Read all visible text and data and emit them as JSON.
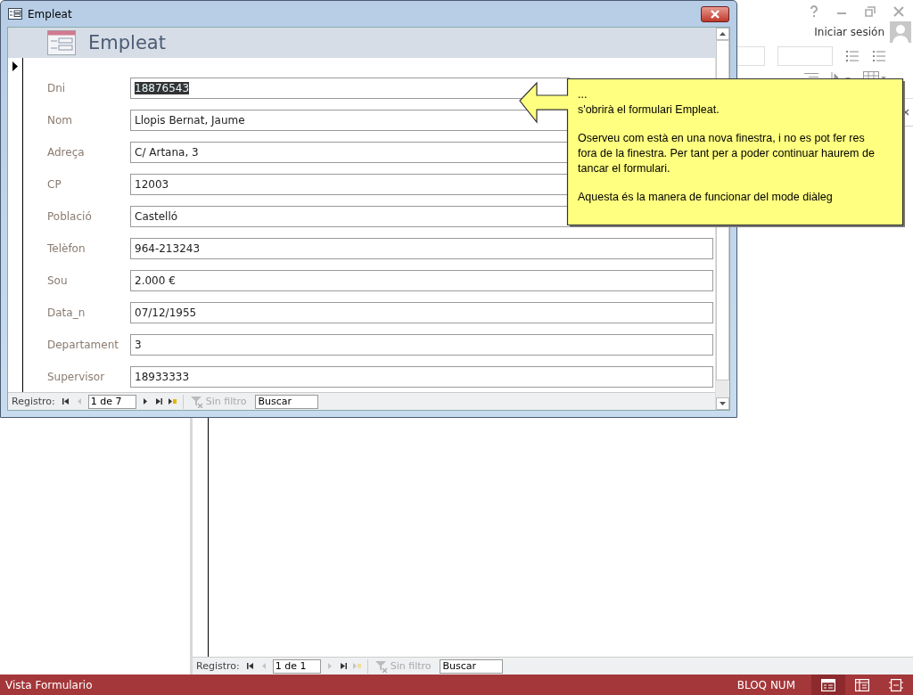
{
  "window": {
    "title": "Empleat"
  },
  "header": {
    "title": "Empleat"
  },
  "fields": [
    {
      "label": "Dni",
      "value": "18876543",
      "selected": true
    },
    {
      "label": "Nom",
      "value": "Llopis Bernat, Jaume",
      "selected": false
    },
    {
      "label": "Adreça",
      "value": "C/ Artana, 3",
      "selected": false
    },
    {
      "label": "CP",
      "value": "12003",
      "selected": false
    },
    {
      "label": "Població",
      "value": "Castelló",
      "selected": false
    },
    {
      "label": "Telèfon",
      "value": "964-213243",
      "selected": false
    },
    {
      "label": "Sou",
      "value": "2.000 €",
      "selected": false
    },
    {
      "label": "Data_n",
      "value": "07/12/1955",
      "selected": false
    },
    {
      "label": "Departament",
      "value": "3",
      "selected": false
    },
    {
      "label": "Supervisor",
      "value": "18933333",
      "selected": false
    }
  ],
  "navigation": {
    "label": "Registro:",
    "record": "1 de 7",
    "filter": "Sin filtro",
    "search": "Buscar",
    "buttons": [
      {
        "kind": "first",
        "disabled": false
      },
      {
        "kind": "prev",
        "disabled": true
      },
      {
        "kind": "next",
        "disabled": false
      },
      {
        "kind": "last",
        "disabled": false
      },
      {
        "kind": "new",
        "disabled": false
      }
    ]
  },
  "background_app": {
    "account": "Iniciar sesión",
    "navigation": {
      "label": "Registro:",
      "record": "1 de 1",
      "filter": "Sin filtro",
      "search": "Buscar",
      "buttons": [
        {
          "kind": "first",
          "disabled": false
        },
        {
          "kind": "prev",
          "disabled": true
        },
        {
          "kind": "next",
          "disabled": true
        },
        {
          "kind": "last",
          "disabled": false
        },
        {
          "kind": "new",
          "disabled": true
        }
      ]
    }
  },
  "callout": {
    "paragraphs": [
      "...\ns'obrirà el formulari Empleat.",
      "Oserveu com està en una nova finestra, i no es pot fer res fora de la finestra. Per tant per a poder continuar haurem de tancar el formulari.",
      "Aquesta és la manera de funcionar del mode diàleg"
    ]
  },
  "status_bar": {
    "view": "Vista Formulario",
    "indicator": "BLOQ NUM",
    "views": [
      {
        "kind": "form",
        "selected": true
      },
      {
        "kind": "datasheet",
        "selected": false
      },
      {
        "kind": "layout",
        "selected": false
      }
    ]
  }
}
